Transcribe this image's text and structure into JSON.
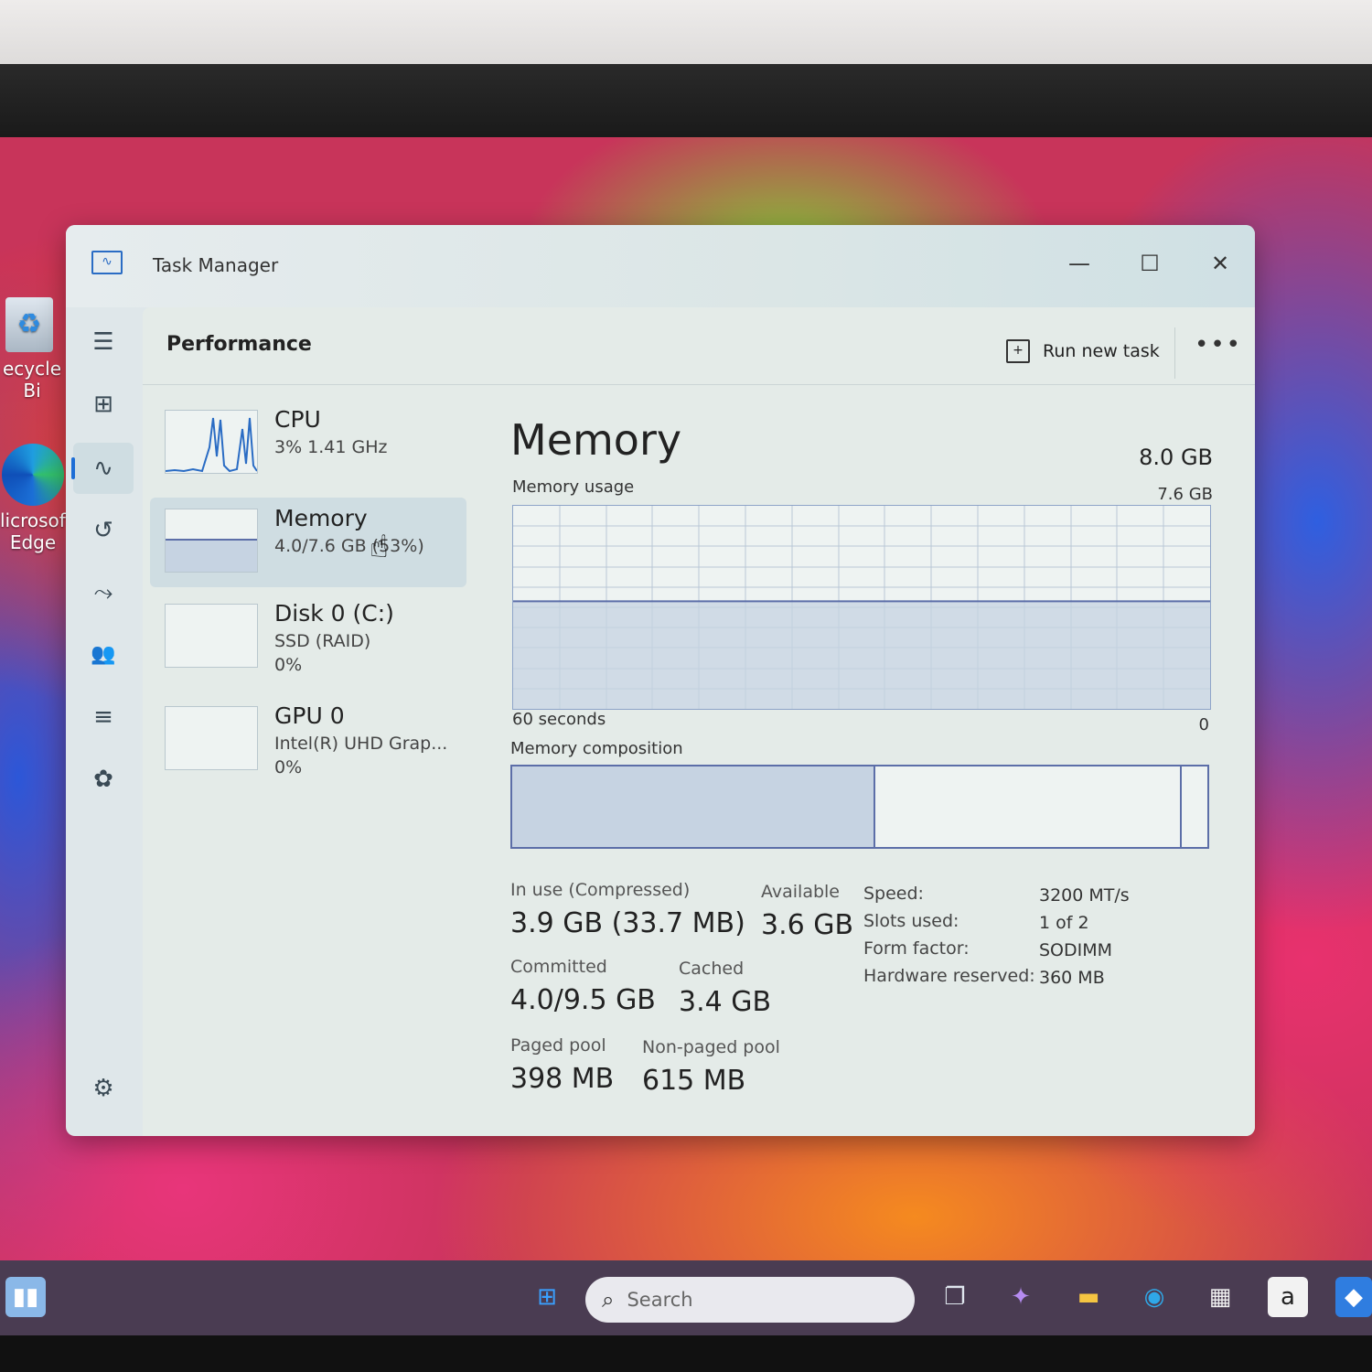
{
  "desktop": {
    "icons": [
      {
        "label": "ecycle Bi"
      },
      {
        "label_line1": "licrosoft",
        "label_line2": "Edge"
      }
    ]
  },
  "window": {
    "title": "Task Manager",
    "controls": {
      "minimize": "—",
      "maximize": "☐",
      "close": "✕"
    }
  },
  "header": {
    "title": "Performance",
    "run_new_task": "Run new task",
    "more": "•••"
  },
  "nav": {
    "items": [
      {
        "name": "hamburger-icon",
        "glyph": "☰"
      },
      {
        "name": "processes-icon",
        "glyph": "⊞"
      },
      {
        "name": "performance-icon",
        "glyph": "∿",
        "active": true
      },
      {
        "name": "app-history-icon",
        "glyph": "↺"
      },
      {
        "name": "startup-apps-icon",
        "glyph": "⤳"
      },
      {
        "name": "users-icon",
        "glyph": "👥"
      },
      {
        "name": "details-icon",
        "glyph": "≡"
      },
      {
        "name": "services-icon",
        "glyph": "✿"
      }
    ],
    "settings": "⚙"
  },
  "devices": [
    {
      "name": "CPU",
      "line1": "3%  1.41 GHz",
      "line2": ""
    },
    {
      "name": "Memory",
      "line1": "4.0/7.6 GB (53%)",
      "line2": ""
    },
    {
      "name": "Disk 0 (C:)",
      "line1": "SSD (RAID)",
      "line2": "0%"
    },
    {
      "name": "GPU 0",
      "line1": "Intel(R) UHD Grap...",
      "line2": "0%"
    }
  ],
  "memory": {
    "title": "Memory",
    "total": "8.0 GB",
    "usage_label": "Memory usage",
    "usage_max": "7.6 GB",
    "time_label": "60 seconds",
    "zero_label": "0",
    "usage_fraction": 0.53,
    "composition_label": "Memory composition",
    "composition": {
      "in_use_fraction": 0.52,
      "modified_fraction": 0.96
    },
    "stats": {
      "in_use_label": "In use (Compressed)",
      "in_use_value": "3.9 GB (33.7 MB)",
      "available_label": "Available",
      "available_value": "3.6 GB",
      "committed_label": "Committed",
      "committed_value": "4.0/9.5 GB",
      "cached_label": "Cached",
      "cached_value": "3.4 GB",
      "paged_label": "Paged pool",
      "paged_value": "398 MB",
      "nonpaged_label": "Non-paged pool",
      "nonpaged_value": "615 MB"
    },
    "specs": [
      {
        "label": "Speed:",
        "value": "3200 MT/s"
      },
      {
        "label": "Slots used:",
        "value": "1 of 2"
      },
      {
        "label": "Form factor:",
        "value": "SODIMM"
      },
      {
        "label": "Hardware reserved:",
        "value": "360 MB"
      }
    ]
  },
  "taskbar": {
    "search_placeholder": "Search"
  },
  "colors": {
    "accent": "#1e6ed6",
    "graph_line": "#5c6ea8",
    "graph_fill": "#c6d3e2"
  }
}
